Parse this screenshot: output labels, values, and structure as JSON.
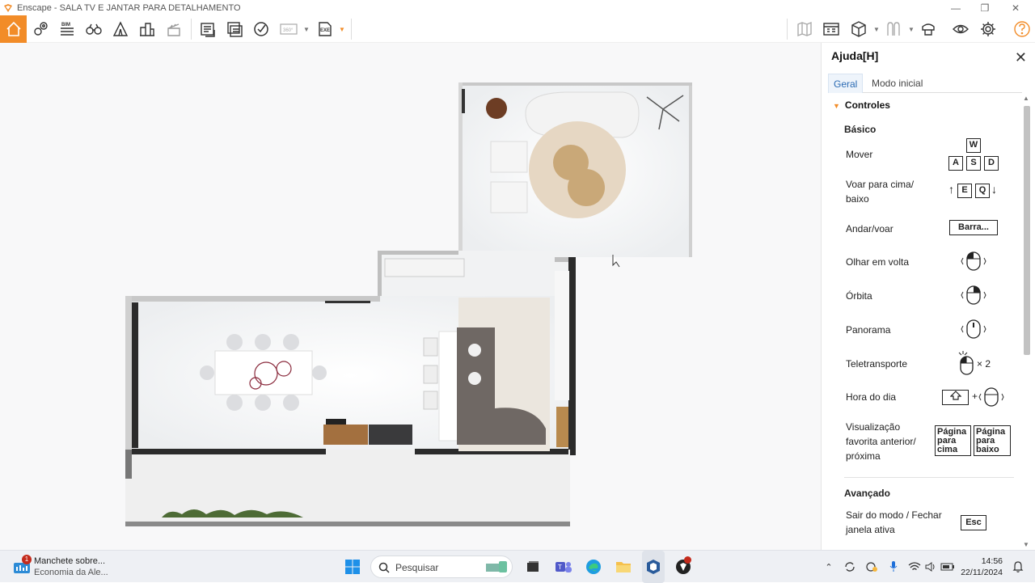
{
  "window": {
    "title": "Enscape - SALA TV E JANTAR PARA DETALHAMENTO",
    "minimize_glyph": "—",
    "maximize_glyph": "❐",
    "close_glyph": "✕"
  },
  "toolbar": {
    "accent_color": "#f28c28",
    "left_icons": [
      "home-icon",
      "map-pin-icon",
      "bim-icon",
      "binoculars-icon",
      "tent-icon",
      "buildings-icon",
      "clapper-icon",
      "screenshot-icon",
      "batch-render-icon",
      "export-video-icon",
      "panorama-360-icon",
      "exe-export-icon"
    ],
    "right_icons": [
      "map-icon",
      "asset-library-icon",
      "cube-icon",
      "materials-icon",
      "collaboration-icon",
      "visibility-icon",
      "settings-icon",
      "help-icon"
    ],
    "bim_label": "BIM",
    "label_360": "360°",
    "exe_label": "EXE",
    "collapse_glyph": "^"
  },
  "help": {
    "title": "Ajuda[H]",
    "close_glyph": "✕",
    "tabs": [
      {
        "label": "Geral",
        "active": true
      },
      {
        "label": "Modo inicial",
        "active": false
      }
    ],
    "section_title": "Controles",
    "basic_title": "Básico",
    "advanced_title": "Avançado",
    "controls": [
      {
        "label": "Mover",
        "keys": [
          "W",
          "A",
          "S",
          "D"
        ]
      },
      {
        "label": "Voar para cima/ baixo",
        "keys": [
          "E",
          "Q"
        ]
      },
      {
        "label": "Andar/voar",
        "keys": [
          "Barra..."
        ]
      },
      {
        "label": "Olhar em volta",
        "input": "left-mouse-button"
      },
      {
        "label": "Órbita",
        "input": "right-mouse-button"
      },
      {
        "label": "Panorama",
        "input": "middle-mouse-button"
      },
      {
        "label": "Teletransporte",
        "input": "double-click",
        "suffix": "× 2"
      },
      {
        "label": "Hora do dia",
        "input": "shift-plus-mouse",
        "plus": "+"
      },
      {
        "label": "Visualização favorita anterior/ próxima",
        "keys": [
          "Página para cima",
          "Página para baixo"
        ]
      },
      {
        "label": "Sair do modo / Fechar janela ativa",
        "keys": [
          "Esc"
        ]
      }
    ]
  },
  "taskbar": {
    "news_title": "Manchete sobre...",
    "news_sub": "Economia da Ale...",
    "news_badge": "1",
    "search_placeholder": "Pesquisar",
    "time": "14:56",
    "date": "22/11/2024",
    "app_icons": [
      "start-icon",
      "search-icon",
      "widgets-icon",
      "task-view-icon",
      "teams-icon",
      "edge-icon",
      "file-explorer-icon",
      "sketchup-icon",
      "enscape-icon"
    ],
    "tray_icons": [
      "chevron-up-icon",
      "sync-icon",
      "onedrive-icon",
      "microphone-icon",
      "wifi-icon",
      "volume-icon",
      "battery-icon",
      "bell-icon"
    ]
  }
}
